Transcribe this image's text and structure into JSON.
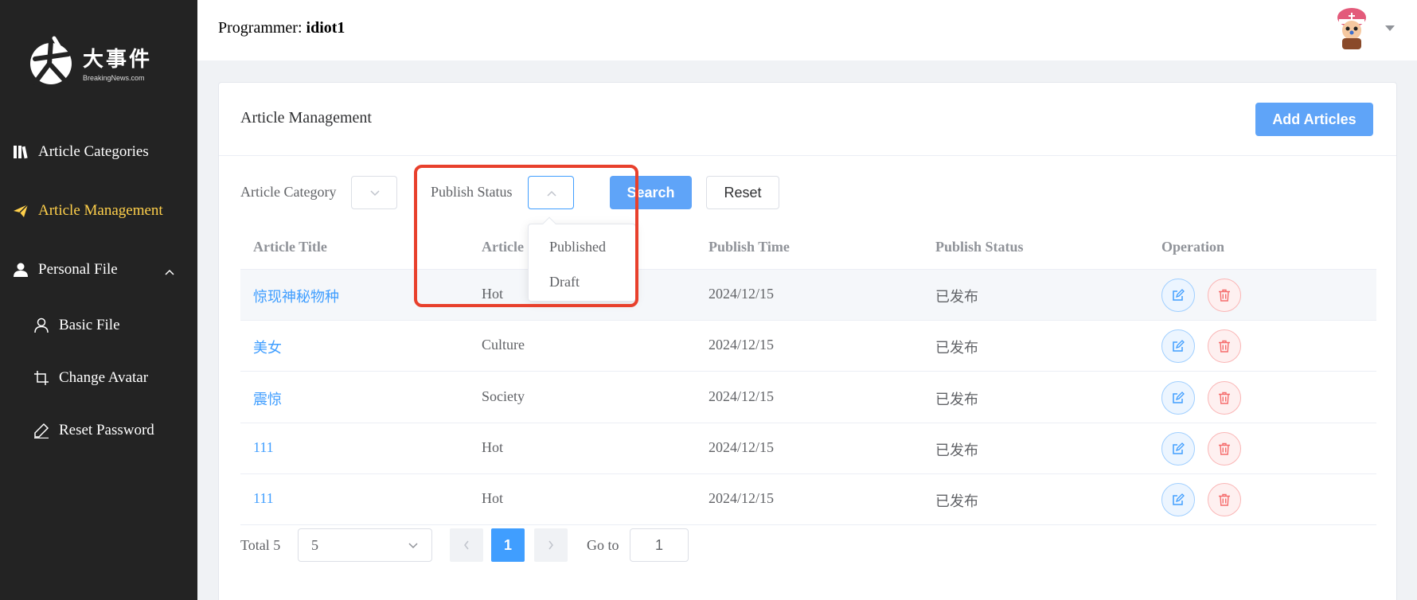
{
  "sidebar": {
    "logo_cn": "大事件",
    "logo_en": "BreakingNews.com",
    "items": [
      {
        "label": "Article Categories"
      },
      {
        "label": "Article Management"
      },
      {
        "label": "Personal File"
      },
      {
        "label": "Basic File"
      },
      {
        "label": "Change Avatar"
      },
      {
        "label": "Reset Password"
      }
    ]
  },
  "header": {
    "programmer_label": "Programmer:",
    "username": "idiot1"
  },
  "card": {
    "title": "Article Management",
    "add_label": "Add Articles"
  },
  "filters": {
    "category_label": "Article Category",
    "status_label": "Publish Status",
    "search_label": "Search",
    "reset_label": "Reset"
  },
  "dropdown": {
    "options": [
      "Published",
      "Draft"
    ]
  },
  "table": {
    "columns": [
      "Article Title",
      "Article Category",
      "Publish Time",
      "Publish Status",
      "Operation"
    ],
    "rows": [
      {
        "title": "惊现神秘物种",
        "category": "Hot",
        "time": "2024/12/15",
        "status": "已发布"
      },
      {
        "title": "美女",
        "category": "Culture",
        "time": "2024/12/15",
        "status": "已发布"
      },
      {
        "title": "震惊",
        "category": "Society",
        "time": "2024/12/15",
        "status": "已发布"
      },
      {
        "title": "111",
        "category": "Hot",
        "time": "2024/12/15",
        "status": "已发布"
      },
      {
        "title": "111",
        "category": "Hot",
        "time": "2024/12/15",
        "status": "已发布"
      }
    ]
  },
  "pagination": {
    "total": "Total 5",
    "page_size": "5",
    "current_page": "1",
    "goto_label": "Go to",
    "goto_value": "1"
  },
  "colors": {
    "sidebar_bg": "#232323",
    "active_nav": "#ffd04b",
    "primary": "#409eff",
    "danger": "#f56c6c",
    "highlight": "#e8402c"
  }
}
